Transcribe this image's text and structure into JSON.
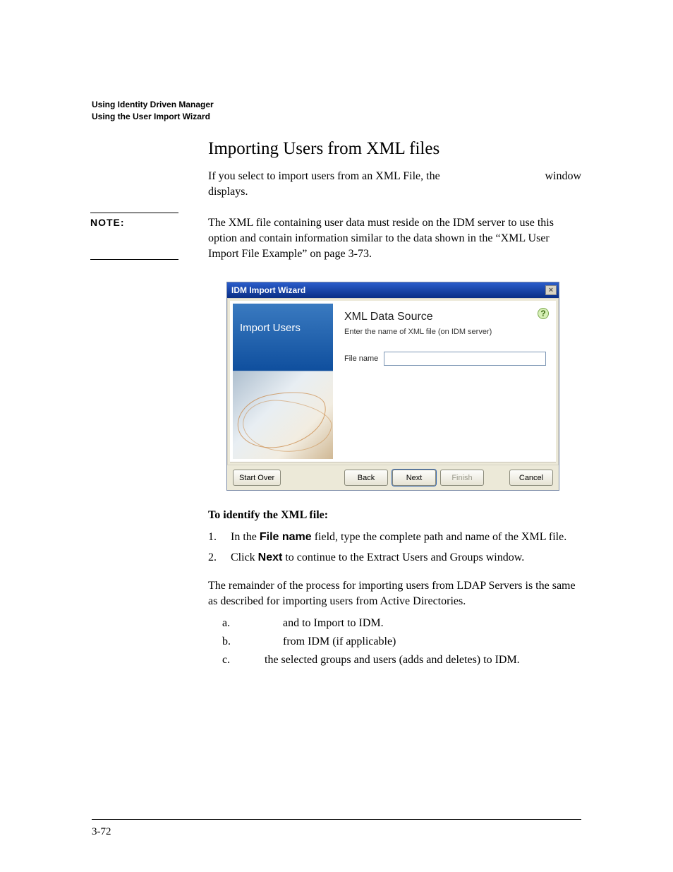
{
  "runningHead": {
    "line1": "Using Identity Driven Manager",
    "line2": "Using the User Import Wizard"
  },
  "section": {
    "title": "Importing Users from XML files",
    "introLine1": "If you select to import users from an XML File, the",
    "introTrailing": "window",
    "introLine2": "displays."
  },
  "note": {
    "label": "NOTE:",
    "text": "The XML file containing user data must reside on the IDM server to use this option and contain information similar to the data shown in the “XML User Import File Example” on page 3-73."
  },
  "wizard": {
    "title": "IDM Import Wizard",
    "closeGlyph": "×",
    "sideTitle": "Import Users",
    "helpGlyph": "?",
    "heading": "XML Data Source",
    "subheading": "Enter the name of XML file (on IDM server)",
    "fieldLabel": "File name",
    "fieldValue": "",
    "buttons": {
      "startOver": "Start Over",
      "back": "Back",
      "next": "Next",
      "finish": "Finish",
      "cancel": "Cancel"
    }
  },
  "identify": {
    "heading": "To identify the XML file:",
    "step1_pre": "In the ",
    "step1_bold": "File name",
    "step1_post": " field, type the complete path and name of the XML file.",
    "step2_pre": "Click ",
    "step2_bold": "Next",
    "step2_post": " to continue to the Extract Users and Groups window."
  },
  "remainder": "The remainder of the process for importing users from LDAP Servers is the same as described for importing users from Active Directories.",
  "sublist": {
    "a_mid1": " and ",
    "a_tail": " to Import to IDM.",
    "b_tail": " from IDM (if applicable)",
    "c_tail": " the selected groups and users (adds and deletes) to IDM."
  },
  "pageNumber": "3-72"
}
